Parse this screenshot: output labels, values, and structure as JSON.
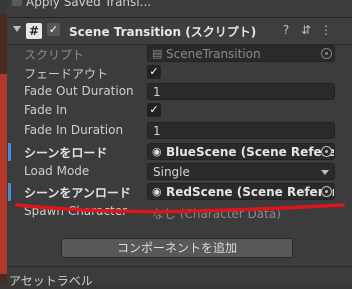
{
  "top_partial_text": "Apply Saved Transi...",
  "header": {
    "script_icon_glyph": "#",
    "enabled_glyph": "✓",
    "title": "Scene Transition (スクリプト)",
    "help_glyph": "?",
    "preset_glyph": "⇵",
    "menu_glyph": "⋮"
  },
  "fields": {
    "script": {
      "label": "スクリプト",
      "value": "SceneTransition",
      "icon_glyph": "▤"
    },
    "fade_out": {
      "label": "フェードアウト",
      "checked_glyph": "✓"
    },
    "fade_out_duration": {
      "label": "Fade Out Duration",
      "value": "1"
    },
    "fade_in": {
      "label": "Fade In",
      "checked_glyph": "✓"
    },
    "fade_in_duration": {
      "label": "Fade In Duration",
      "value": "1"
    },
    "load_scene": {
      "label": "シーンをロード",
      "value": "BlueScene (Scene Referen",
      "icon_glyph": "◉"
    },
    "load_mode": {
      "label": "Load Mode",
      "value": "Single"
    },
    "unload_scene": {
      "label": "シーンをアンロード",
      "value": "RedScene (Scene Referenc",
      "icon_glyph": "◉"
    },
    "spawn_character": {
      "label": "Spawn Character",
      "value": "なし (Character Data)"
    }
  },
  "add_component_label": "コンポーネントを追加",
  "bottom_partial_text": "アセットラベル",
  "colors": {
    "accent_blue": "#4a8ad8",
    "annotation_red": "#e0141c",
    "panel_bg": "#3c3c3c"
  }
}
